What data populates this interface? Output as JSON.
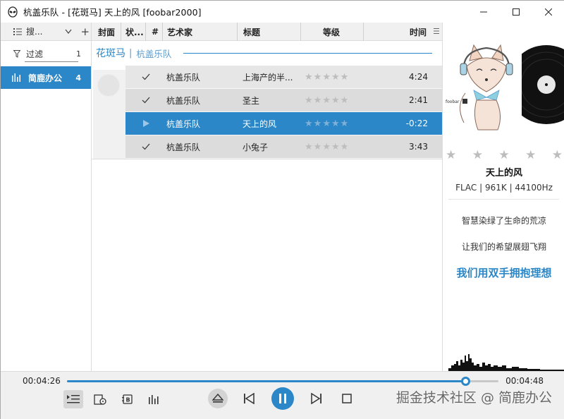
{
  "window": {
    "title": "杭盖乐队 - [花斑马] 天上的风  [foobar2000]"
  },
  "left_panel": {
    "sort_label": "搜...",
    "filter_label": "过滤",
    "filter_count": "1",
    "items": [
      {
        "label": "简鹿办公",
        "count": "4",
        "selected": true
      }
    ]
  },
  "playlist": {
    "columns": [
      "封面",
      "状...",
      "#",
      "艺术家",
      "标题",
      "等级",
      "时间"
    ],
    "group": {
      "album": "花斑马",
      "separator": "|",
      "artist": "杭盖乐队"
    },
    "rows": [
      {
        "status": "check",
        "artist": "杭盖乐队",
        "title": "上海产的半...",
        "rating": 0,
        "time": "4:24",
        "playing": false
      },
      {
        "status": "check",
        "artist": "杭盖乐队",
        "title": "圣主",
        "rating": 0,
        "time": "2:41",
        "playing": false
      },
      {
        "status": "play",
        "artist": "杭盖乐队",
        "title": "天上的风",
        "rating": 0,
        "time": "-0:22",
        "playing": true
      },
      {
        "status": "check",
        "artist": "杭盖乐队",
        "title": "小兔子",
        "rating": 0,
        "time": "3:43",
        "playing": false
      }
    ]
  },
  "now_playing": {
    "art_text": "foobar",
    "rating": 0,
    "title": "天上的风",
    "format": "FLAC | 961K | 44100Hz",
    "lyrics": [
      "智慧染绿了生命的荒凉",
      "让我们的希望展翅飞翔"
    ],
    "current_lyric": "我们用双手拥抱理想"
  },
  "transport": {
    "elapsed": "00:04:26",
    "total": "00:04:48",
    "progress": 0.924
  },
  "watermark": "掘金技术社区 @ 简鹿办公",
  "colors": {
    "accent": "#2b87c7",
    "row": "#e6e6e6",
    "row_alt": "#dcdcdc",
    "toolbar": "#f0f0f0"
  },
  "icons": {
    "app": "alien-icon",
    "minimize": "minimize-icon",
    "maximize": "maximize-icon",
    "close": "close-icon"
  }
}
